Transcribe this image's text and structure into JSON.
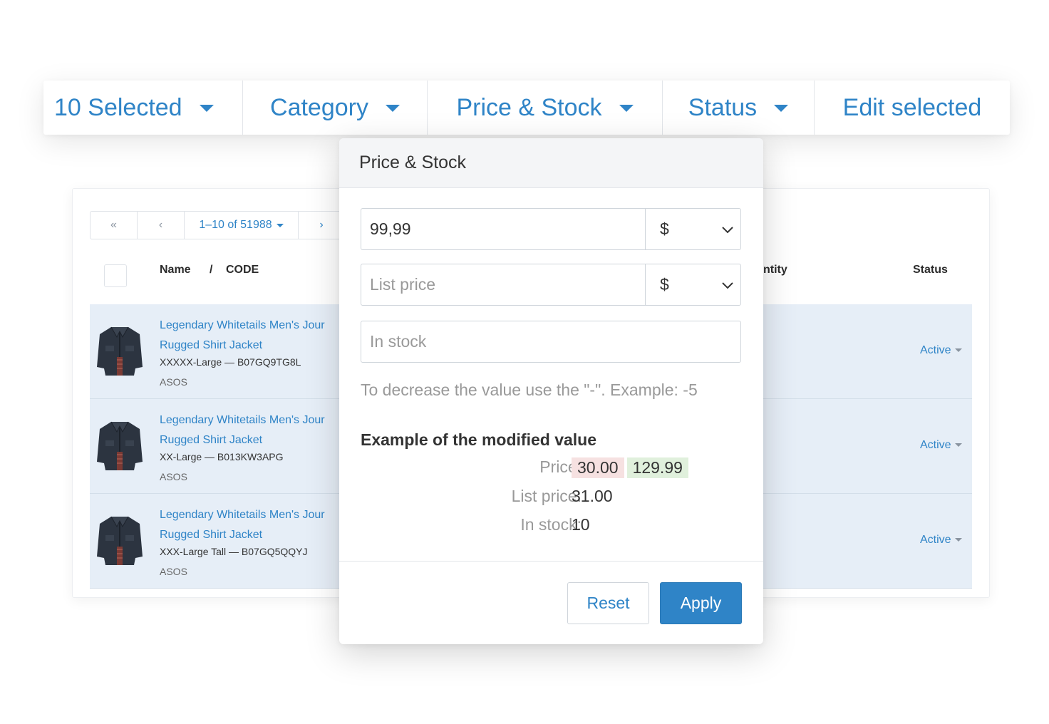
{
  "toolbar": {
    "selected": "10 Selected",
    "category": "Category",
    "price_stock": "Price & Stock",
    "status": "Status",
    "edit_selected": "Edit selected"
  },
  "pager": {
    "first": "«",
    "prev": "‹",
    "range": "1–10 of 51988",
    "next": "›"
  },
  "table": {
    "headers": {
      "name": "Name",
      "slash": "/",
      "code": "CODE",
      "quantity": "ntity",
      "status": "Status"
    },
    "rows": [
      {
        "name_line1": "Legendary Whitetails Men's Jour",
        "name_line2": "Rugged Shirt Jacket",
        "variant": "XXXXX-Large — B07GQ9TG8L",
        "brand": "ASOS",
        "status": "Active"
      },
      {
        "name_line1": "Legendary Whitetails Men's Jour",
        "name_line2": "Rugged Shirt Jacket",
        "variant": "XX-Large — B013KW3APG",
        "brand": "ASOS",
        "status": "Active"
      },
      {
        "name_line1": "Legendary Whitetails Men's Jour",
        "name_line2": "Rugged Shirt Jacket",
        "variant": "XXX-Large Tall — B07GQ5QQYJ",
        "brand": "ASOS",
        "status": "Active"
      }
    ]
  },
  "popup": {
    "title": "Price & Stock",
    "price_value": "99,99",
    "price_currency": "$",
    "list_price_placeholder": "List price",
    "list_price_currency": "$",
    "in_stock_placeholder": "In stock",
    "hint": "To decrease the value use the \"-\". Example: -5",
    "example_title": "Example of the modified value",
    "example": {
      "price_label": "Price:",
      "price_old": "30.00",
      "price_new": "129.99",
      "list_price_label": "List price:",
      "list_price_value": "31.00",
      "in_stock_label": "In stock:",
      "in_stock_value": "10"
    },
    "reset_label": "Reset",
    "apply_label": "Apply"
  },
  "colors": {
    "accent": "#2f84c7",
    "row_selected": "#e6eef7",
    "old_value_bg": "#f6e1e1",
    "new_value_bg": "#e0f0dc"
  }
}
